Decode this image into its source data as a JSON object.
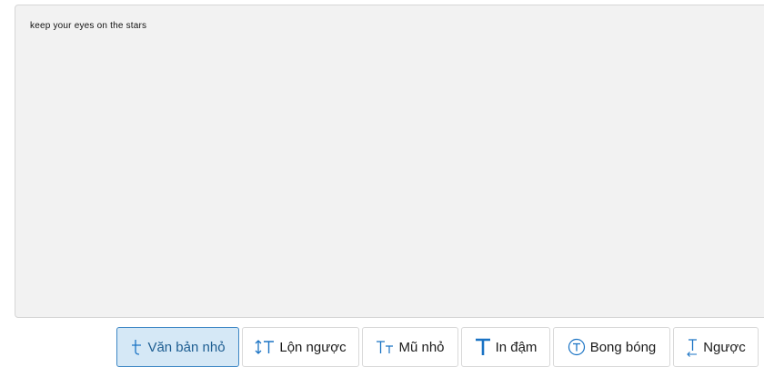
{
  "editor": {
    "text": "keep your eyes on the stars"
  },
  "toolbar": {
    "buttons": [
      {
        "label": "Văn bản nhỏ",
        "icon": "small-text-icon",
        "active": true
      },
      {
        "label": "Lộn ngược",
        "icon": "upside-down-icon",
        "active": false
      },
      {
        "label": "Mũ nhỏ",
        "icon": "small-caps-icon",
        "active": false
      },
      {
        "label": "In đậm",
        "icon": "bold-t-icon",
        "active": false
      },
      {
        "label": "Bong bóng",
        "icon": "bubble-t-icon",
        "active": false
      },
      {
        "label": "Ngược",
        "icon": "reverse-t-icon",
        "active": false
      }
    ]
  },
  "colors": {
    "accent": "#1a73c4",
    "active_bg": "#d5e8f6",
    "active_border": "#3f88c5",
    "editor_bg": "#f2f2f2"
  }
}
